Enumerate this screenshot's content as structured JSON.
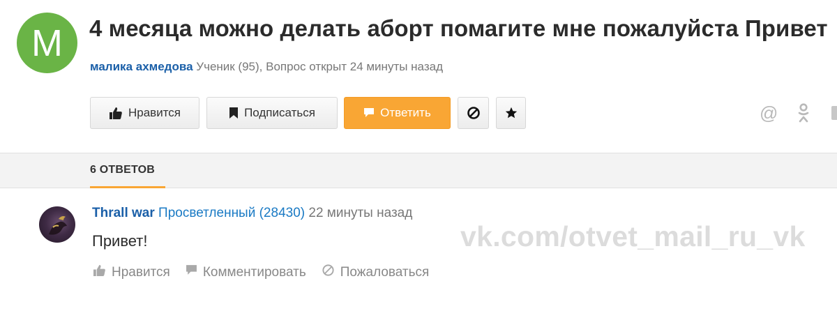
{
  "question": {
    "avatar_letter": "M",
    "avatar_color": "#6ab446",
    "title": "4 месяца можно делать аборт помагите мне пожалуйста Привет",
    "author": "малика ахмедова",
    "meta": "Ученик (95), Вопрос открыт 24 минуты назад"
  },
  "actions": {
    "like_label": "Нравится",
    "subscribe_label": "Подписаться",
    "reply_label": "Ответить",
    "share_at": "@"
  },
  "tabs": {
    "answers_label": "6 ОТВЕТОВ"
  },
  "answer": {
    "user": "Thrall war",
    "rank": "Просветленный (28430)",
    "time": "22 минуты назад",
    "text": "Привет!",
    "like_label": "Нравится",
    "comment_label": "Комментировать",
    "report_label": "Пожаловаться"
  },
  "watermark": "vk.com/otvet_mail_ru_vk",
  "colors": {
    "accent": "#f9a634",
    "link": "#1a5fa8",
    "avatar": "#6ab446"
  }
}
